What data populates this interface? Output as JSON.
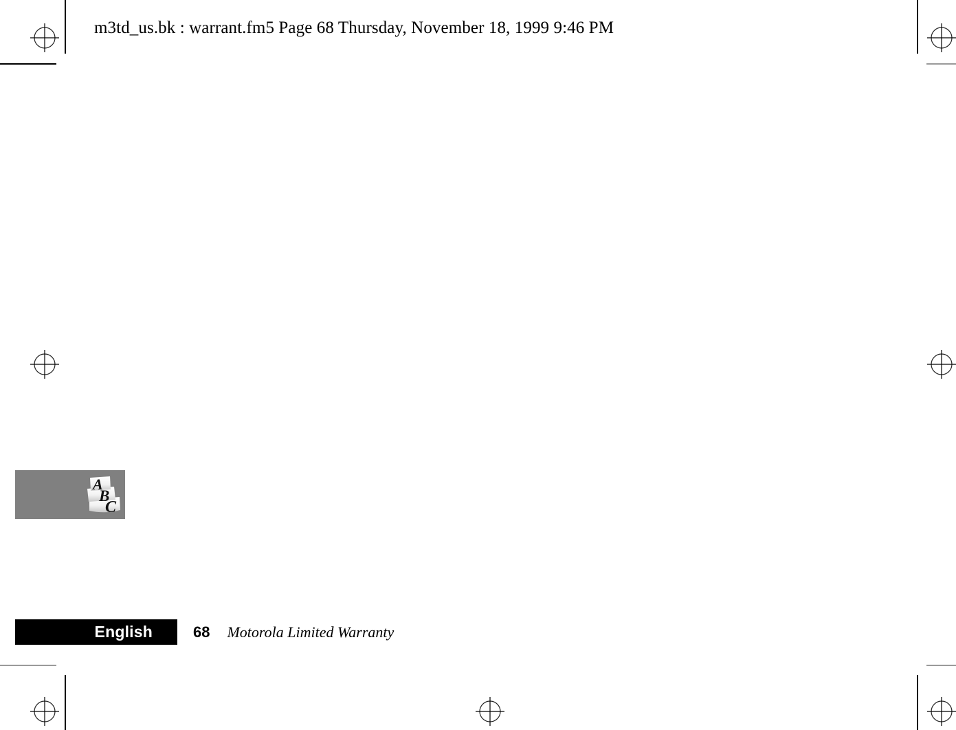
{
  "document": {
    "header": {
      "text": "m3td_us.bk : warrant.fm5  Page 68  Thursday, November 18, 1999  9:46 PM",
      "file_book": "m3td_us.bk",
      "file_chapter": "warrant.fm5",
      "page_label": "Page 68",
      "timestamp": "Thursday, November 18, 1999  9:46 PM"
    },
    "body": {
      "content": ""
    },
    "logo": {
      "name": "abc-logo",
      "letters": [
        "A",
        "B",
        "C"
      ],
      "box_color": "#808080",
      "letter_color": "#000000",
      "ribbon_color": "#ffffff"
    },
    "footer": {
      "language_label": "English",
      "language_bar_color": "#000000",
      "language_text_color": "#ffffff",
      "page_number": "68",
      "section_title": "Motorola Limited Warranty"
    },
    "print_marks": {
      "trim_line_color": "#000000",
      "trim_line_color_light": "#9a9a9a",
      "registration_marks": [
        "top-left",
        "top-right",
        "middle-left",
        "middle-right",
        "bottom-left",
        "bottom-center",
        "bottom-right"
      ]
    }
  }
}
